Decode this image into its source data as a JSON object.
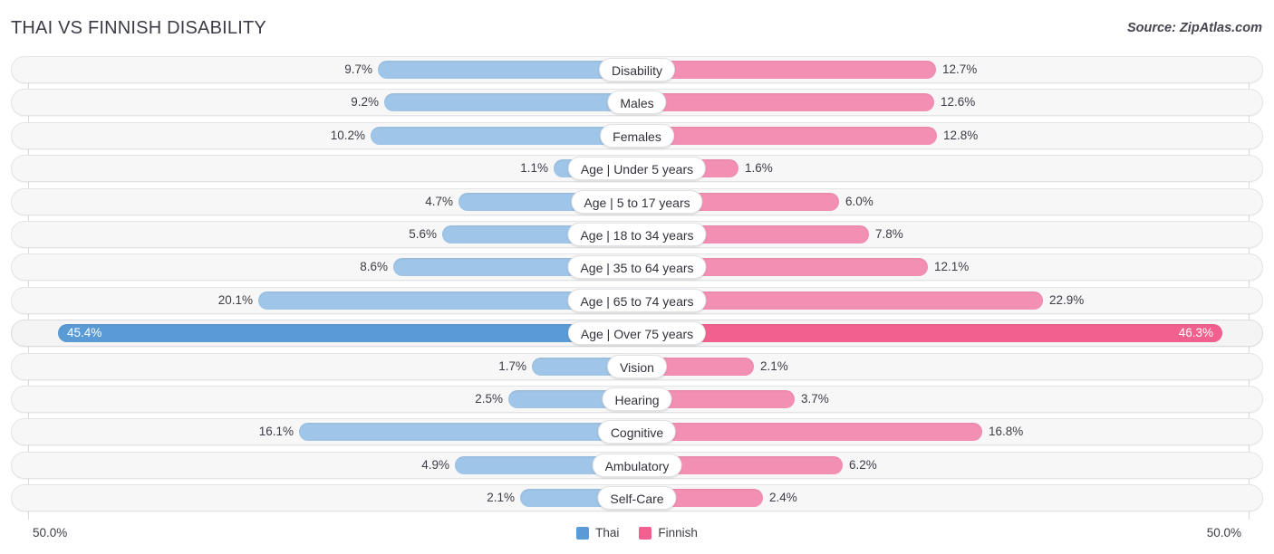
{
  "header": {
    "title": "THAI VS FINNISH DISABILITY",
    "source": "Source: ZipAtlas.com"
  },
  "axis": {
    "min_label": "50.0%",
    "max_label": "50.0%",
    "scale_max": 50.0
  },
  "legend": {
    "items": [
      {
        "label": "Thai",
        "color": "#5b9bd5",
        "swatch": "thai"
      },
      {
        "label": "Finnish",
        "color": "#f2608f",
        "swatch": "finnish"
      }
    ]
  },
  "colors": {
    "thai_bar": "#9fc5e8",
    "finnish_bar": "#f48fb4",
    "thai_bar_highlight": "#5b9bd5",
    "finnish_bar_highlight": "#f2608f",
    "track": "#f7f7f8",
    "text": "#3c3c46"
  },
  "chart_data": {
    "type": "bar",
    "title": "THAI VS FINNISH DISABILITY",
    "subtitle": "Source: ZipAtlas.com",
    "orientation": "horizontal-diverging",
    "xlabel": "",
    "ylabel": "",
    "xlim": [
      50.0,
      50.0
    ],
    "grid": false,
    "legend_position": "bottom-center",
    "categories": [
      "Disability",
      "Males",
      "Females",
      "Age | Under 5 years",
      "Age | 5 to 17 years",
      "Age | 18 to 34 years",
      "Age | 35 to 64 years",
      "Age | 65 to 74 years",
      "Age | Over 75 years",
      "Vision",
      "Hearing",
      "Cognitive",
      "Ambulatory",
      "Self-Care"
    ],
    "series": [
      {
        "name": "Thai",
        "values": [
          9.7,
          9.2,
          10.2,
          1.1,
          4.7,
          5.6,
          8.6,
          20.1,
          45.4,
          1.7,
          2.5,
          16.1,
          4.9,
          2.1
        ],
        "labels": [
          "9.7%",
          "9.2%",
          "10.2%",
          "1.1%",
          "4.7%",
          "5.6%",
          "8.6%",
          "20.1%",
          "45.4%",
          "1.7%",
          "2.5%",
          "16.1%",
          "4.9%",
          "2.1%"
        ]
      },
      {
        "name": "Finnish",
        "values": [
          12.7,
          12.6,
          12.8,
          1.6,
          6.0,
          7.8,
          12.1,
          22.9,
          46.3,
          2.1,
          3.7,
          16.8,
          6.2,
          2.4
        ],
        "labels": [
          "12.7%",
          "12.6%",
          "12.8%",
          "1.6%",
          "6.0%",
          "7.8%",
          "12.1%",
          "22.9%",
          "46.3%",
          "2.1%",
          "3.7%",
          "16.8%",
          "6.2%",
          "2.4%"
        ]
      }
    ],
    "highlighted_category": "Age | Over 75 years"
  },
  "rows": [
    {
      "label": "Disability",
      "left_value": 9.7,
      "left_label": "9.7%",
      "right_value": 12.7,
      "right_label": "12.7%",
      "highlight": false
    },
    {
      "label": "Males",
      "left_value": 9.2,
      "left_label": "9.2%",
      "right_value": 12.6,
      "right_label": "12.6%",
      "highlight": false
    },
    {
      "label": "Females",
      "left_value": 10.2,
      "left_label": "10.2%",
      "right_value": 12.8,
      "right_label": "12.8%",
      "highlight": false
    },
    {
      "label": "Age | Under 5 years",
      "left_value": 1.1,
      "left_label": "1.1%",
      "right_value": 1.6,
      "right_label": "1.6%",
      "highlight": false
    },
    {
      "label": "Age | 5 to 17 years",
      "left_value": 4.7,
      "left_label": "4.7%",
      "right_value": 6.0,
      "right_label": "6.0%",
      "highlight": false
    },
    {
      "label": "Age | 18 to 34 years",
      "left_value": 5.6,
      "left_label": "5.6%",
      "right_value": 7.8,
      "right_label": "7.8%",
      "highlight": false
    },
    {
      "label": "Age | 35 to 64 years",
      "left_value": 8.6,
      "left_label": "8.6%",
      "right_value": 12.1,
      "right_label": "12.1%",
      "highlight": false
    },
    {
      "label": "Age | 65 to 74 years",
      "left_value": 20.1,
      "left_label": "20.1%",
      "right_value": 22.9,
      "right_label": "22.9%",
      "highlight": false
    },
    {
      "label": "Age | Over 75 years",
      "left_value": 45.4,
      "left_label": "45.4%",
      "right_value": 46.3,
      "right_label": "46.3%",
      "highlight": true
    },
    {
      "label": "Vision",
      "left_value": 1.7,
      "left_label": "1.7%",
      "right_value": 2.1,
      "right_label": "2.1%",
      "highlight": false
    },
    {
      "label": "Hearing",
      "left_value": 2.5,
      "left_label": "2.5%",
      "right_value": 3.7,
      "right_label": "3.7%",
      "highlight": false
    },
    {
      "label": "Cognitive",
      "left_value": 16.1,
      "left_label": "16.1%",
      "right_value": 16.8,
      "right_label": "16.8%",
      "highlight": false
    },
    {
      "label": "Ambulatory",
      "left_value": 4.9,
      "left_label": "4.9%",
      "right_value": 6.2,
      "right_label": "6.2%",
      "highlight": false
    },
    {
      "label": "Self-Care",
      "left_value": 2.1,
      "left_label": "2.1%",
      "right_value": 2.4,
      "right_label": "2.4%",
      "highlight": false
    }
  ]
}
